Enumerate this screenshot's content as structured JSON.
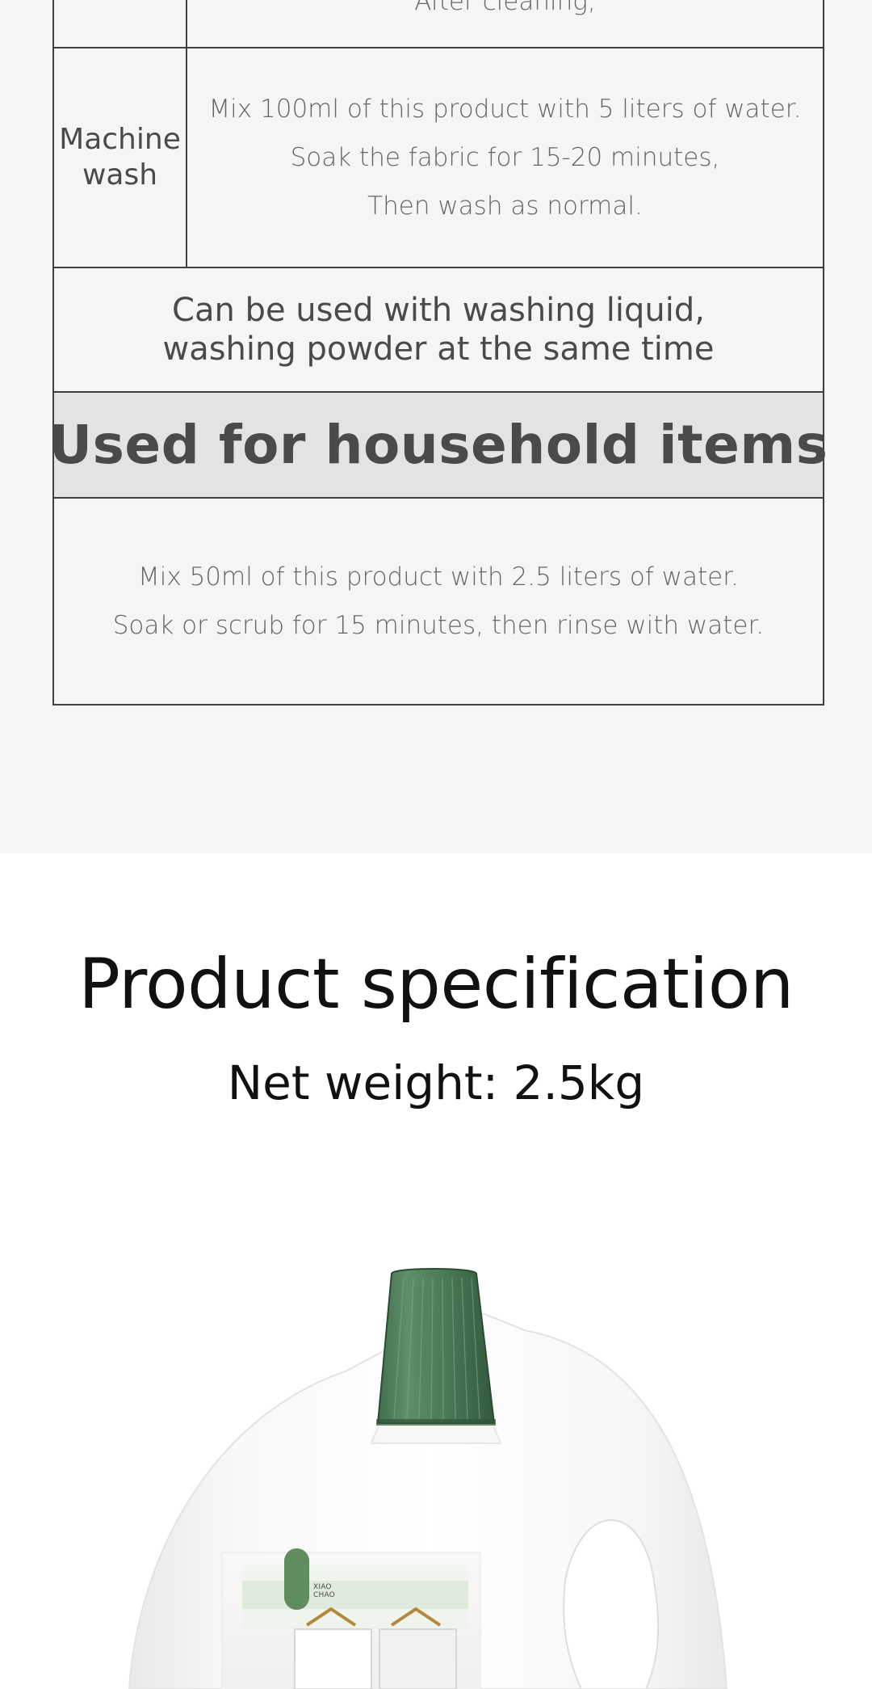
{
  "top_row": {
    "cut_text": "After cleaning,"
  },
  "machine_wash": {
    "label_line1": "Machine",
    "label_line2": "wash",
    "lines": [
      "Mix 100ml of this product with 5 liters of water.",
      "Soak the fabric for 15-20 minutes,",
      "Then wash as normal."
    ]
  },
  "compat": {
    "line1": "Can be used with washing liquid,",
    "line2": "washing powder at the same time"
  },
  "household": {
    "title": "Used for household items",
    "lines": [
      "Mix 50ml of this product with 2.5 liters of water.",
      "Soak or scrub for 15 minutes, then rinse with water."
    ]
  },
  "spec": {
    "title": "Product specification",
    "weight": "Net weight: 2.5kg"
  },
  "product": {
    "brand_line1": "XIAO",
    "brand_line2": "CHAO"
  },
  "colors": {
    "table_border": "#3f3f3f",
    "header_bg": "#e3e3e3",
    "page_bg": "#f5f5f5",
    "cap_green": "#5f8d5f"
  }
}
